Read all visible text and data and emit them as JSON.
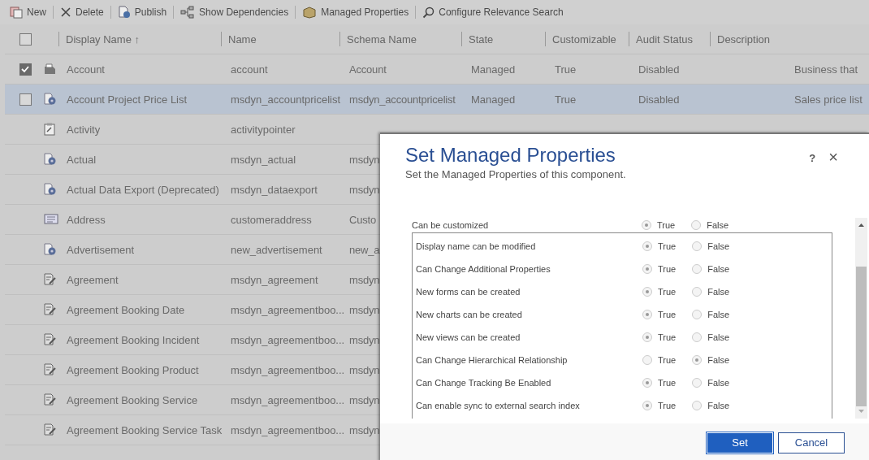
{
  "toolbar": [
    {
      "label": "New"
    },
    {
      "label": "Delete"
    },
    {
      "label": "Publish"
    },
    {
      "label": "Show Dependencies"
    },
    {
      "label": "Managed Properties"
    },
    {
      "label": "Configure Relevance Search"
    }
  ],
  "table": {
    "select_all": {
      "checked": false
    },
    "columns": [
      "Display Name ↑",
      "Name",
      "Schema Name",
      "State",
      "Customizable",
      "Audit Status",
      "Description"
    ],
    "rows": [
      {
        "kind": "entity",
        "checked": true,
        "highlighted": false,
        "cells": [
          "Account",
          "account",
          "Account",
          "Managed",
          "True",
          "Disabled",
          "Business that"
        ]
      },
      {
        "kind": "custom",
        "checked": false,
        "highlighted": true,
        "cells": [
          "Account Project Price List",
          "msdyn_accountpricelist",
          "msdyn_accountpricelist",
          "Managed",
          "True",
          "Disabled",
          "Sales price list"
        ]
      },
      {
        "kind": "activity",
        "cells": [
          "Activity",
          "activitypointer"
        ]
      },
      {
        "kind": "custom",
        "cells": [
          "Actual",
          "msdyn_actual",
          "msdyn"
        ]
      },
      {
        "kind": "custom",
        "cells": [
          "Actual Data Export (Deprecated)",
          "msdyn_dataexport",
          "msdyn"
        ]
      },
      {
        "kind": "address",
        "cells": [
          "Address",
          "customeraddress",
          "Custo"
        ]
      },
      {
        "kind": "custom",
        "cells": [
          "Advertisement",
          "new_advertisement",
          "new_a"
        ]
      },
      {
        "kind": "form",
        "cells": [
          "Agreement",
          "msdyn_agreement",
          "msdyn"
        ]
      },
      {
        "kind": "form",
        "cells": [
          "Agreement Booking Date",
          "msdyn_agreementboo...",
          "msdyn"
        ]
      },
      {
        "kind": "form",
        "cells": [
          "Agreement Booking Incident",
          "msdyn_agreementboo...",
          "msdyn"
        ]
      },
      {
        "kind": "form",
        "cells": [
          "Agreement Booking Product",
          "msdyn_agreementboo...",
          "msdyn"
        ]
      },
      {
        "kind": "form",
        "cells": [
          "Agreement Booking Service",
          "msdyn_agreementboo...",
          "msdyn"
        ]
      },
      {
        "kind": "form",
        "cells": [
          "Agreement Booking Service Task",
          "msdyn_agreementboo...",
          "msdyn"
        ]
      }
    ]
  },
  "dialog": {
    "title": "Set Managed Properties",
    "subtitle": "Set the Managed Properties of this component.",
    "help": "?",
    "close": "×",
    "top_property": {
      "label": "Can be customized",
      "options": [
        {
          "label": "True",
          "selected": true
        },
        {
          "label": "False",
          "selected": false
        }
      ]
    },
    "properties": [
      {
        "label": "Display name can be modified",
        "options": [
          {
            "label": "True",
            "selected": true
          },
          {
            "label": "False",
            "selected": false
          }
        ]
      },
      {
        "label": "Can Change Additional Properties",
        "options": [
          {
            "label": "True",
            "selected": true
          },
          {
            "label": "False",
            "selected": false
          }
        ]
      },
      {
        "label": "New forms can be created",
        "options": [
          {
            "label": "True",
            "selected": true
          },
          {
            "label": "False",
            "selected": false
          }
        ]
      },
      {
        "label": "New charts can be created",
        "options": [
          {
            "label": "True",
            "selected": true
          },
          {
            "label": "False",
            "selected": false
          }
        ]
      },
      {
        "label": "New views can be created",
        "options": [
          {
            "label": "True",
            "selected": true
          },
          {
            "label": "False",
            "selected": false
          }
        ]
      },
      {
        "label": "Can Change Hierarchical Relationship",
        "options": [
          {
            "label": "True",
            "selected": false
          },
          {
            "label": "False",
            "selected": true
          }
        ]
      },
      {
        "label": "Can Change Tracking Be Enabled",
        "options": [
          {
            "label": "True",
            "selected": true
          },
          {
            "label": "False",
            "selected": false
          }
        ]
      },
      {
        "label": "Can enable sync to external search index",
        "options": [
          {
            "label": "True",
            "selected": true
          },
          {
            "label": "False",
            "selected": false
          }
        ]
      }
    ],
    "buttons": [
      {
        "label": "Set",
        "primary": true
      },
      {
        "label": "Cancel",
        "primary": false
      }
    ]
  }
}
